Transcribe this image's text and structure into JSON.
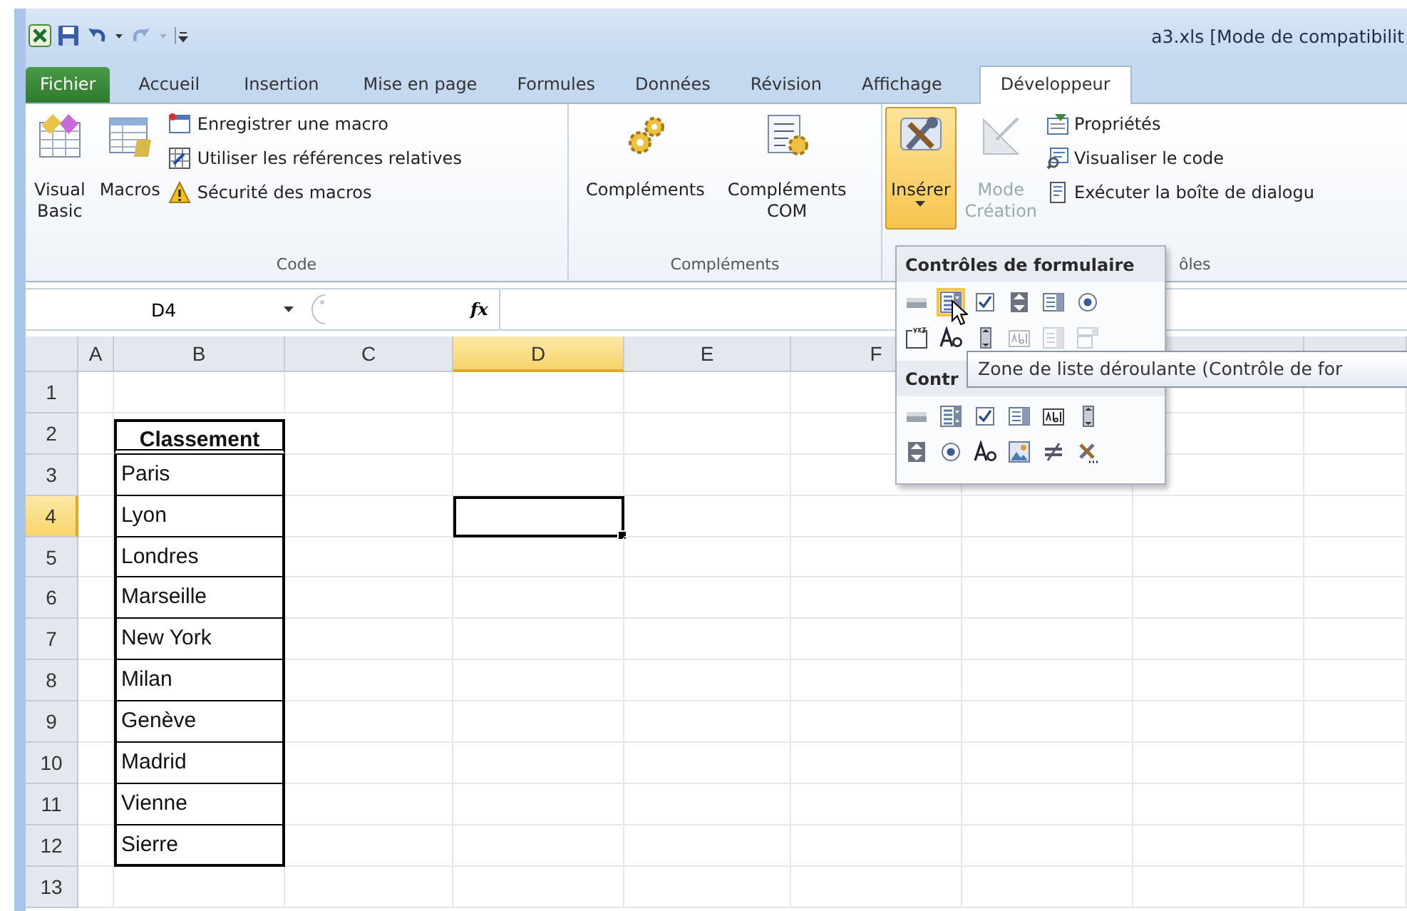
{
  "window": {
    "title": "a3.xls  [Mode de compatibilit"
  },
  "quick_access": [
    {
      "kind": "save",
      "disabled": false
    },
    {
      "kind": "undo",
      "disabled": false
    },
    {
      "kind": "redo",
      "disabled": true
    }
  ],
  "tabs": [
    {
      "label": "Fichier",
      "kind": "file",
      "selected": false
    },
    {
      "label": "Accueil",
      "kind": "tab",
      "selected": false
    },
    {
      "label": "Insertion",
      "kind": "tab",
      "selected": false
    },
    {
      "label": "Mise en page",
      "kind": "tab",
      "selected": false
    },
    {
      "label": "Formules",
      "kind": "tab",
      "selected": false
    },
    {
      "label": "Données",
      "kind": "tab",
      "selected": false
    },
    {
      "label": "Révision",
      "kind": "tab",
      "selected": false
    },
    {
      "label": "Affichage",
      "kind": "tab",
      "selected": false
    },
    {
      "label": "Développeur",
      "kind": "tab",
      "selected": true
    }
  ],
  "ribbon": {
    "groups": [
      {
        "label": "Code",
        "items": [
          {
            "kind": "large",
            "label": "Visual\nBasic",
            "pressed": false,
            "disabled": false
          },
          {
            "kind": "large",
            "label": "Macros",
            "pressed": false,
            "disabled": false
          },
          {
            "kind": "small",
            "label": "Enregistrer une macro",
            "disabled": false
          },
          {
            "kind": "small",
            "label": "Utiliser les références relatives",
            "disabled": false
          },
          {
            "kind": "small",
            "label": "Sécurité des macros",
            "disabled": false
          }
        ]
      },
      {
        "label": "Compléments",
        "items": [
          {
            "kind": "large",
            "label": "Compléments",
            "pressed": false,
            "disabled": false
          },
          {
            "kind": "large",
            "label": "Compléments\nCOM",
            "pressed": false,
            "disabled": false
          }
        ]
      },
      {
        "label": "ôles",
        "items": [
          {
            "kind": "large",
            "label": "Insérer",
            "pressed": true,
            "disabled": false
          },
          {
            "kind": "large",
            "label": "Mode\nCréation",
            "pressed": false,
            "disabled": true
          },
          {
            "kind": "small",
            "label": "Propriétés",
            "disabled": false
          },
          {
            "kind": "small",
            "label": "Visualiser le code",
            "disabled": false
          },
          {
            "kind": "small",
            "label": "Exécuter la boîte de dialogu",
            "disabled": false
          }
        ]
      }
    ]
  },
  "formula_bar": {
    "name_box": "D4",
    "function_label": "fx"
  },
  "sheet": {
    "columns": [
      {
        "label": "A",
        "selected": false
      },
      {
        "label": "B",
        "selected": false
      },
      {
        "label": "C",
        "selected": false
      },
      {
        "label": "D",
        "selected": true
      },
      {
        "label": "E",
        "selected": false
      },
      {
        "label": "F",
        "selected": false
      }
    ],
    "rows": [
      {
        "label": "1",
        "selected": false
      },
      {
        "label": "2",
        "selected": false
      },
      {
        "label": "3",
        "selected": false
      },
      {
        "label": "4",
        "selected": true
      },
      {
        "label": "5",
        "selected": false
      },
      {
        "label": "6",
        "selected": false
      },
      {
        "label": "7",
        "selected": false
      },
      {
        "label": "8",
        "selected": false
      },
      {
        "label": "9",
        "selected": false
      },
      {
        "label": "10",
        "selected": false
      },
      {
        "label": "11",
        "selected": false
      },
      {
        "label": "12",
        "selected": false
      },
      {
        "label": "13",
        "selected": false
      }
    ],
    "table": {
      "header": "Classement",
      "items": [
        "Paris",
        "Lyon",
        "Londres",
        "Marseille",
        "New York",
        "Milan",
        "Genève",
        "Madrid",
        "Vienne",
        "Sierre"
      ]
    }
  },
  "insert_menu": {
    "sections": [
      {
        "title": "Contrôles de formulaire",
        "controls": [
          {
            "kind": "button",
            "selected": false,
            "disabled": false
          },
          {
            "kind": "combo",
            "selected": true,
            "disabled": false
          },
          {
            "kind": "checkbox",
            "selected": false,
            "disabled": false
          },
          {
            "kind": "spin",
            "selected": false,
            "disabled": false
          },
          {
            "kind": "listbox",
            "selected": false,
            "disabled": false
          },
          {
            "kind": "option",
            "selected": false,
            "disabled": false
          },
          {
            "kind": "groupbox",
            "selected": false,
            "disabled": false
          },
          {
            "kind": "label",
            "selected": false,
            "disabled": false
          },
          {
            "kind": "scrollbar",
            "selected": false,
            "disabled": false
          },
          {
            "kind": "textfield",
            "selected": false,
            "disabled": true
          },
          {
            "kind": "combolist",
            "selected": false,
            "disabled": true
          },
          {
            "kind": "combodrop",
            "selected": false,
            "disabled": true
          }
        ]
      },
      {
        "title": "Contr",
        "controls": [
          {
            "kind": "button",
            "selected": false,
            "disabled": false
          },
          {
            "kind": "combo",
            "selected": false,
            "disabled": false
          },
          {
            "kind": "checkbox",
            "selected": false,
            "disabled": false
          },
          {
            "kind": "listbox",
            "selected": false,
            "disabled": false
          },
          {
            "kind": "textfield",
            "selected": false,
            "disabled": false
          },
          {
            "kind": "scrollbar",
            "selected": false,
            "disabled": false
          },
          {
            "kind": "spin",
            "selected": false,
            "disabled": false
          },
          {
            "kind": "option",
            "selected": false,
            "disabled": false
          },
          {
            "kind": "label",
            "selected": false,
            "disabled": false
          },
          {
            "kind": "image",
            "selected": false,
            "disabled": false
          },
          {
            "kind": "toggle",
            "selected": false,
            "disabled": false
          },
          {
            "kind": "more",
            "selected": false,
            "disabled": false
          }
        ]
      }
    ]
  },
  "tooltip": {
    "text": "Zone de liste déroulante (Contrôle de for"
  }
}
